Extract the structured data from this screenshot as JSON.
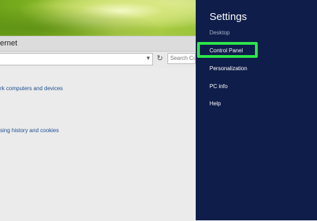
{
  "browser": {
    "window_title": "ernet",
    "search_placeholder": "Search Co",
    "content_links": [
      "rk computers and devices",
      "sing history and cookies"
    ]
  },
  "charm": {
    "title": "Settings",
    "subtitle": "Desktop",
    "items": [
      {
        "label": "Control Panel",
        "highlighted": true
      },
      {
        "label": "Personalization",
        "highlighted": false
      },
      {
        "label": "PC info",
        "highlighted": false
      },
      {
        "label": "Help",
        "highlighted": false
      }
    ],
    "background_color": "#0f1d4a",
    "highlight_color": "#2ee64a"
  },
  "icons": {
    "dropdown": "chevron-down-icon",
    "refresh": "refresh-icon"
  }
}
